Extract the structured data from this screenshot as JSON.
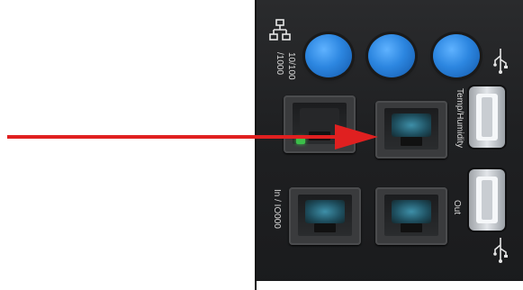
{
  "labels": {
    "net_speed": [
      "10/100",
      "/1000"
    ],
    "temp_humidity": "Temp/Humidity",
    "in_port": "In / IO000",
    "out_port": "Out"
  },
  "icons": {
    "network": "network-icon",
    "usb_top": "usb-icon",
    "usb_bottom": "usb-icon"
  },
  "colors": {
    "arrow": "#e02020",
    "button_blue": "#2c86e0",
    "panel": "#1f2022"
  }
}
